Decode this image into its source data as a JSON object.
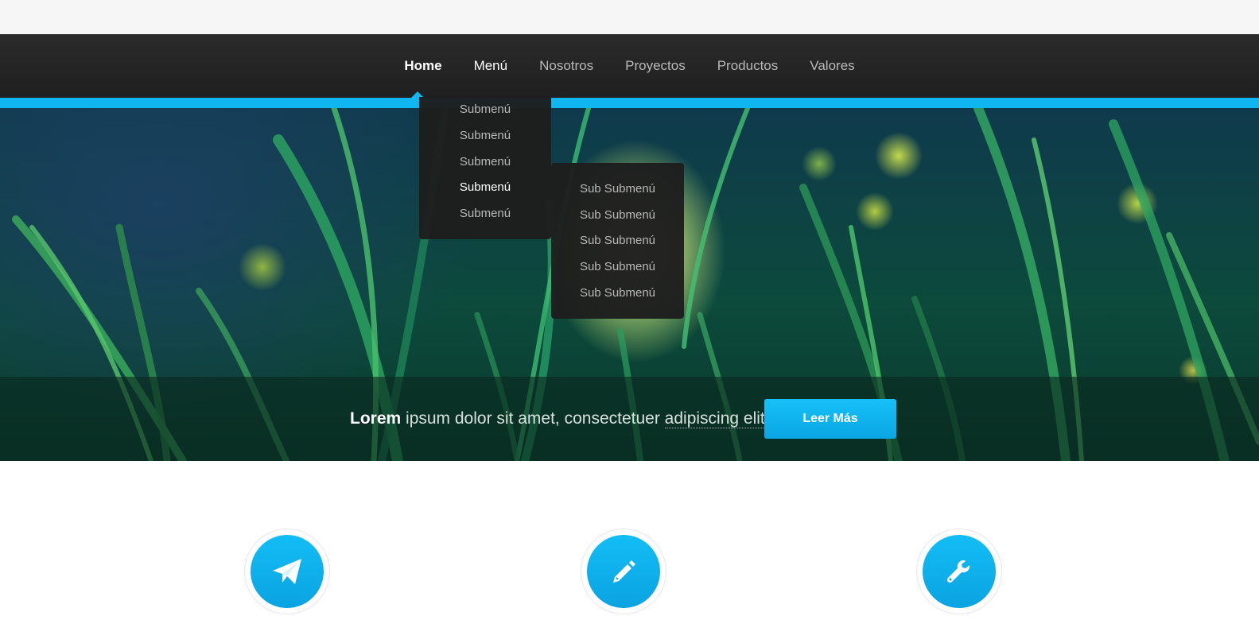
{
  "nav": {
    "items": [
      {
        "label": "Home"
      },
      {
        "label": "Menú"
      },
      {
        "label": "Nosotros"
      },
      {
        "label": "Proyectos"
      },
      {
        "label": "Productos"
      },
      {
        "label": "Valores"
      }
    ],
    "active": "Home"
  },
  "dropdown": {
    "items": [
      "Submenú",
      "Submenú",
      "Submenú",
      "Submenú",
      "Submenú"
    ],
    "highlighted_index": 3
  },
  "subdropdown": {
    "items": [
      "Sub Submenú",
      "Sub Submenú",
      "Sub Submenú",
      "Sub Submenú",
      "Sub Submenú"
    ]
  },
  "hero": {
    "caption_lead": "Lorem",
    "caption_rest": " ipsum dolor sit amet, consectetuer ",
    "caption_link": "adipiscing elit.",
    "button_label": "Leer Más"
  },
  "features": [
    {
      "icon": "paper-plane-icon"
    },
    {
      "icon": "pencil-icon"
    },
    {
      "icon": "wrench-icon"
    }
  ],
  "colors": {
    "accent": "#10b6ef",
    "nav_bg": "#252525",
    "dropdown_bg": "#1e1e1e"
  }
}
